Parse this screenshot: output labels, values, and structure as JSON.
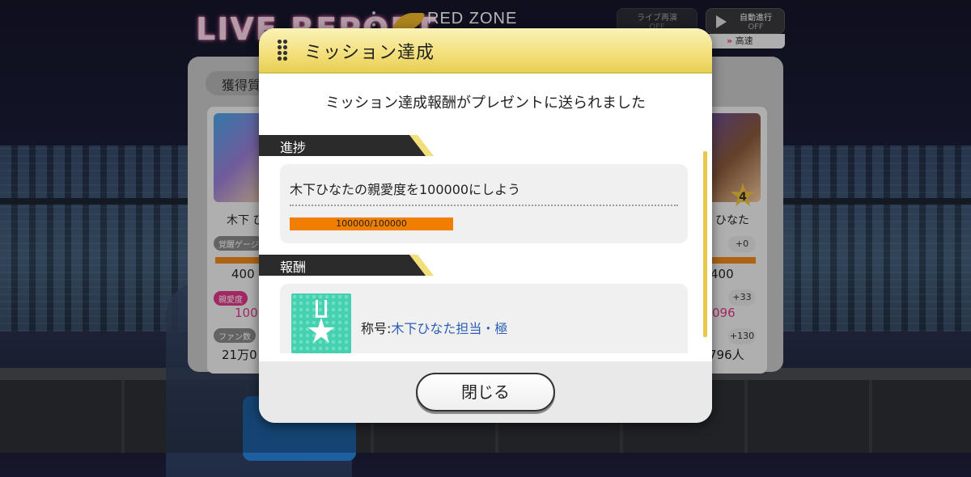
{
  "header": {
    "live_report": "LIVE REPORT",
    "zone": "RED ZONE",
    "replay_button": {
      "label": "ライブ再演",
      "state": "OFF"
    },
    "auto_button": {
      "label": "自動進行",
      "state": "OFF"
    },
    "speed_label": "高速"
  },
  "background_panel": {
    "tab": "獲得質",
    "left_card": {
      "name": "木下 ひ",
      "gauge_label": "覚醒ゲージ",
      "gauge_value": "400",
      "affection_label": "親愛度",
      "affection_value": "100",
      "fans_label": "ファン数",
      "fans_value": "21万0"
    },
    "right_card": {
      "name": "ひなた",
      "rarity": "4",
      "gauge_value": "400",
      "gauge_delta": "+0",
      "affection_value": "096",
      "affection_delta": "+33",
      "fans_value": "796人",
      "fans_delta": "+130"
    }
  },
  "modal": {
    "title": "ミッション達成",
    "message": "ミッション達成報酬がプレゼントに送られました",
    "progress_section": {
      "heading": "進捗",
      "mission": "木下ひなたの親愛度を100000にしよう",
      "current": 100000,
      "target": 100000,
      "progress_text": "100000/100000"
    },
    "reward_section": {
      "heading": "報酬",
      "reward_prefix": "称号:",
      "reward_name": "木下ひなた担当・極"
    },
    "close_label": "閉じる"
  },
  "colors": {
    "accent_gold": "#f3df7a",
    "progress": "#f07e00",
    "reward_link": "#2a5db8",
    "neon_pink": "#ff6fb0"
  },
  "icons": [
    "grip-icon",
    "play-icon",
    "fast-forward-icon",
    "medal-icon",
    "star-rarity-icon",
    "zone-wing-icon"
  ]
}
